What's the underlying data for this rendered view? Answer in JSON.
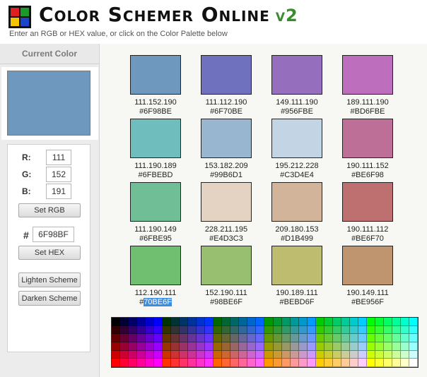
{
  "header": {
    "title": "Color Schemer Online",
    "version": "v2",
    "subtitle": "Enter an RGB or HEX value, or click on the Color Palette below",
    "logo_colors": [
      "#e02020",
      "#1a9a2a",
      "#f4c400",
      "#1c44c8"
    ]
  },
  "left_panel": {
    "heading": "Current Color",
    "current_color": "#6F98BE",
    "r_label": "R:",
    "g_label": "G:",
    "b_label": "B:",
    "r_value": "111",
    "g_value": "152",
    "b_value": "191",
    "set_rgb_label": "Set RGB",
    "hash_label": "#",
    "hex_value": "6F98BF",
    "set_hex_label": "Set HEX",
    "lighten_label": "Lighten Scheme",
    "darken_label": "Darken Scheme"
  },
  "scheme": [
    {
      "rgb": "111.152.190",
      "hex_label": "#6F98BE",
      "color": "#6F98BE"
    },
    {
      "rgb": "111.112.190",
      "hex_label": "#6F70BE",
      "color": "#6F70BE"
    },
    {
      "rgb": "149.111.190",
      "hex_label": "#956FBE",
      "color": "#956FBE"
    },
    {
      "rgb": "189.111.190",
      "hex_label": "#BD6FBE",
      "color": "#BD6FBE"
    },
    {
      "rgb": "111.190.189",
      "hex_label": "#6FBEBD",
      "color": "#6FBEBD"
    },
    {
      "rgb": "153.182.209",
      "hex_label": "#99B6D1",
      "color": "#99B6D1"
    },
    {
      "rgb": "195.212.228",
      "hex_label": "#C3D4E4",
      "color": "#C3D4E4"
    },
    {
      "rgb": "190.111.152",
      "hex_label": "#BE6F98",
      "color": "#BE6F98"
    },
    {
      "rgb": "111.190.149",
      "hex_label": "#6FBE95",
      "color": "#6FBE95"
    },
    {
      "rgb": "228.211.195",
      "hex_label": "#E4D3C3",
      "color": "#E4D3C3"
    },
    {
      "rgb": "209.180.153",
      "hex_label": "#D1B499",
      "color": "#D1B499"
    },
    {
      "rgb": "190.111.112",
      "hex_label": "#BE6F70",
      "color": "#BE6F70"
    },
    {
      "rgb": "112.190.111",
      "hex_label": "#70BE6F",
      "color": "#70BE6F",
      "selected_text": "70BE6F"
    },
    {
      "rgb": "152.190.111",
      "hex_label": "#98BE6F",
      "color": "#98BE6F"
    },
    {
      "rgb": "190.189.111",
      "hex_label": "#BEBD6F",
      "color": "#BEBD6F"
    },
    {
      "rgb": "190.149.111",
      "hex_label": "#BE956F",
      "color": "#BE956F"
    }
  ],
  "palette": {
    "columns": 36,
    "rows": 6
  }
}
